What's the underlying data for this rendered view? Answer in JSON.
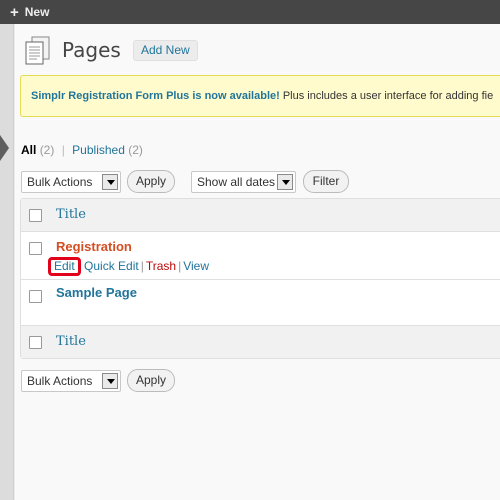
{
  "admin_bar": {
    "new_label": "New",
    "icon": "plus-icon"
  },
  "header": {
    "title": "Pages",
    "add_new_label": "Add New",
    "icon": "pages-icon"
  },
  "notice": {
    "strong_text": "Simplr Registration Form Plus is now available!",
    "rest_text": " Plus includes a user interface for adding fie"
  },
  "filters": {
    "all_label": "All",
    "all_count": "(2)",
    "separator": "|",
    "published_label": "Published",
    "published_count": "(2)"
  },
  "top_controls": {
    "bulk_actions": "Bulk Actions",
    "apply_label": "Apply",
    "dates": "Show all dates",
    "filter_label": "Filter"
  },
  "table": {
    "column_title": "Title",
    "rows": [
      {
        "title": "Registration",
        "actions": {
          "edit": "Edit",
          "quick_edit": "Quick Edit",
          "trash": "Trash",
          "view": "View",
          "sep": "|"
        }
      },
      {
        "title": "Sample Page"
      }
    ]
  },
  "bottom_controls": {
    "bulk_actions": "Bulk Actions",
    "apply_label": "Apply"
  },
  "colors": {
    "link": "#21759b",
    "accent_orange": "#d54e21",
    "trash": "#bc0b0b",
    "highlight": "#e3001b",
    "notice_bg": "#fffbcc"
  }
}
